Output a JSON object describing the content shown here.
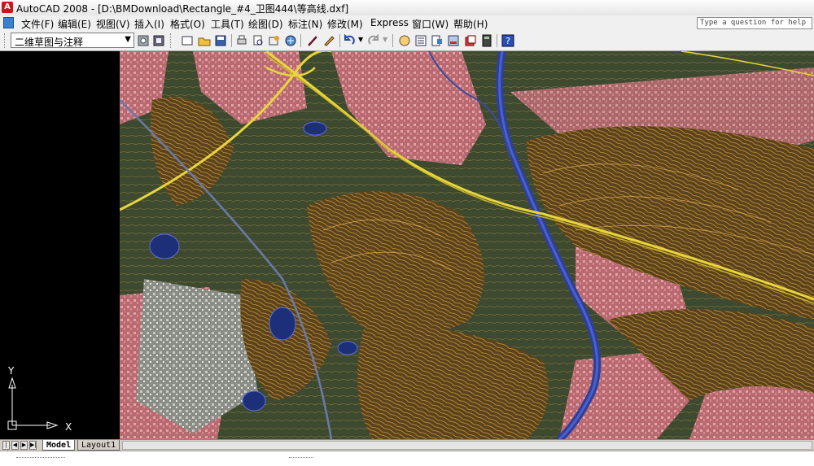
{
  "window": {
    "title": "AutoCAD 2008 - [D:\\BMDownload\\Rectangle_#4_卫图444\\等高线.dxf]",
    "app_icon_letter": "A"
  },
  "menu": {
    "items": [
      "文件(F)",
      "编辑(E)",
      "视图(V)",
      "插入(I)",
      "格式(O)",
      "工具(T)",
      "绘图(D)",
      "标注(N)",
      "修改(M)",
      "Express",
      "窗口(W)",
      "帮助(H)"
    ],
    "help_placeholder": "Type a question for help"
  },
  "toolbar": {
    "workspace": "二维草图与注释",
    "icons": [
      "workspace-settings-icon",
      "workspace-lock-icon",
      "new-icon",
      "open-icon",
      "save-icon",
      "plot-icon",
      "plot-preview-icon",
      "publish-icon",
      "3d-dwf-icon",
      "match-properties-icon",
      "block-editor-icon",
      "undo-icon",
      "redo-icon",
      "pan-icon",
      "properties-icon",
      "design-center-icon",
      "tool-palettes-icon",
      "sheet-set-icon",
      "markup-icon",
      "quickcalc-icon",
      "help-icon"
    ]
  },
  "ucs": {
    "x_label": "X",
    "y_label": "Y"
  },
  "tabs": {
    "model": "Model",
    "layout1": "Layout1"
  },
  "colors": {
    "contour": "#d9a441",
    "road": "#e8d63a",
    "river": "#2c3f9e",
    "urban": "#c9747e",
    "forest": "#4a4a2a",
    "canvas_bg": "#000000"
  }
}
